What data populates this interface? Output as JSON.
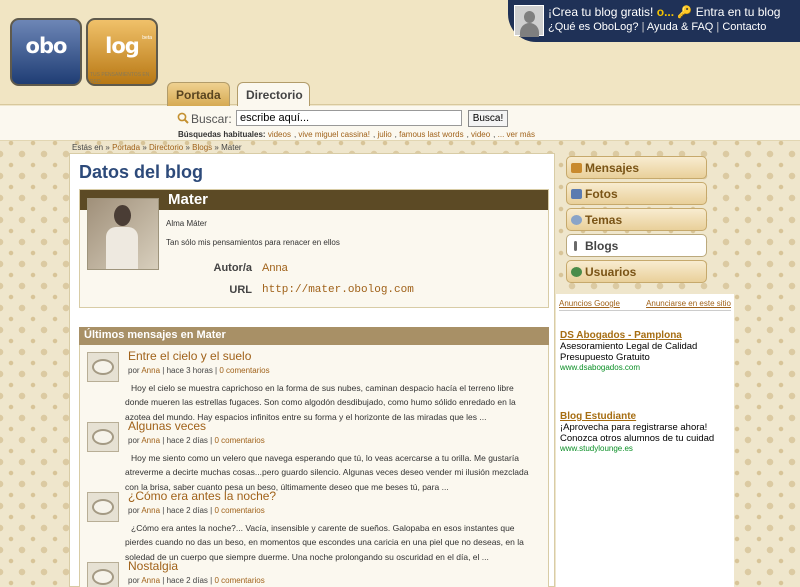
{
  "header": {
    "logo_left": "obo",
    "logo_right": "log",
    "logo_beta": "beta",
    "logo_tagline": "TUS PENSAMIENTOS EN RED",
    "top_create": "¡Crea tu blog gratis!",
    "top_or": "o...",
    "top_login": "Entra en tu blog",
    "top_links": [
      "¿Qué es OboLog?",
      "Ayuda & FAQ",
      "Contacto"
    ]
  },
  "tabs": [
    {
      "label": "Portada",
      "active": false
    },
    {
      "label": "Directorio",
      "active": true
    }
  ],
  "search": {
    "label": "Buscar:",
    "value": "escribe aquí...",
    "button": "Busca!",
    "habituales_label": "Búsquedas habituales:",
    "habituales": [
      "videos",
      "vive miguel cassina!",
      "julio",
      "famous last words",
      "video",
      "... ver más"
    ]
  },
  "breadcrumb": {
    "prefix": "Estás en",
    "items": [
      "Portada",
      "Directorio",
      "Blogs",
      "Mater"
    ],
    "separator": "»"
  },
  "main": {
    "title": "Datos del blog",
    "blog": {
      "name": "Mater",
      "subtitle": "Alma Máter",
      "description": "Tan sólo mis pensamientos para renacer en ellos",
      "author_label": "Autor/a",
      "author": "Anna",
      "url_label": "URL",
      "url": "http://mater.obolog.com"
    },
    "posts_header": "Últimos mensajes en Mater",
    "posts": [
      {
        "title": "Entre el cielo y el suelo",
        "by": "por",
        "author": "Anna",
        "time": "hace 3 horas",
        "comments": "0 comentarios",
        "excerpt": "Hoy el cielo se muestra caprichoso en la forma de sus nubes, caminan despacio hacía el terreno libre donde mueren las estrellas fugaces. Son como algodón desdibujado, como humo sólido enredado en la azotea del mundo. Hay espacios infinitos entre su forma y el horizonte de las miradas que les ..."
      },
      {
        "title": "Algunas veces",
        "by": "por",
        "author": "Anna",
        "time": "hace 2 días",
        "comments": "0 comentarios",
        "excerpt": "Hoy me siento como un velero que navega esperando que tú, lo veas acercarse a tu orilla. Me gustaría atreverme a decirte muchas cosas...pero guardo silencio.   Algunas veces deseo vender mi ilusión mezclada con la brisa, saber cuanto pesa un beso, últimamente deseo que me beses tú, para ..."
      },
      {
        "title": "¿Cómo era antes la noche?",
        "by": "por",
        "author": "Anna",
        "time": "hace 2 días",
        "comments": "0 comentarios",
        "excerpt": "¿Cómo era antes la noche?...      Vacía, insensible y carente de sueños. Galopaba en esos instantes que pierdes cuando no das un beso, en momentos que escondes una caricia en una piel que no deseas, en la soledad de un cuerpo que siempre duerme. Una noche prolongando su oscuridad en el día, el ..."
      },
      {
        "title": "Nostalgia",
        "by": "por",
        "author": "Anna",
        "time": "hace 2 días",
        "comments": "0 comentarios",
        "excerpt": ""
      }
    ]
  },
  "nav": [
    {
      "label": "Mensajes",
      "icon": "messages-icon",
      "active": false
    },
    {
      "label": "Fotos",
      "icon": "photos-icon",
      "active": false
    },
    {
      "label": "Temas",
      "icon": "topics-icon",
      "active": false
    },
    {
      "label": "Blogs",
      "icon": "blogs-icon",
      "active": true
    },
    {
      "label": "Usuarios",
      "icon": "users-icon",
      "active": false
    }
  ],
  "ads": {
    "google_label": "Anuncios Google",
    "advertise_label": "Anunciarse en este sitio",
    "items": [
      {
        "title": "DS Abogados - Pamplona",
        "lines": [
          "Asesoramiento Legal de Calidad",
          "Presupuesto Gratuito"
        ],
        "url": "www.dsabogados.com"
      },
      {
        "title": "Blog Estudiante",
        "lines": [
          "¡Aprovecha para registrarse ahora!",
          "Conozca otros alumnos de tu cuidad"
        ],
        "url": "www.studylounge.es"
      }
    ]
  },
  "colors": {
    "top_band": "#1f3157",
    "highlight": "#f4c400",
    "title_blue": "#2d4a7a",
    "blog_header": "#5c4a25",
    "posts_header": "#a89066",
    "link": "#a0621a",
    "ad_url": "#0a8f25"
  }
}
